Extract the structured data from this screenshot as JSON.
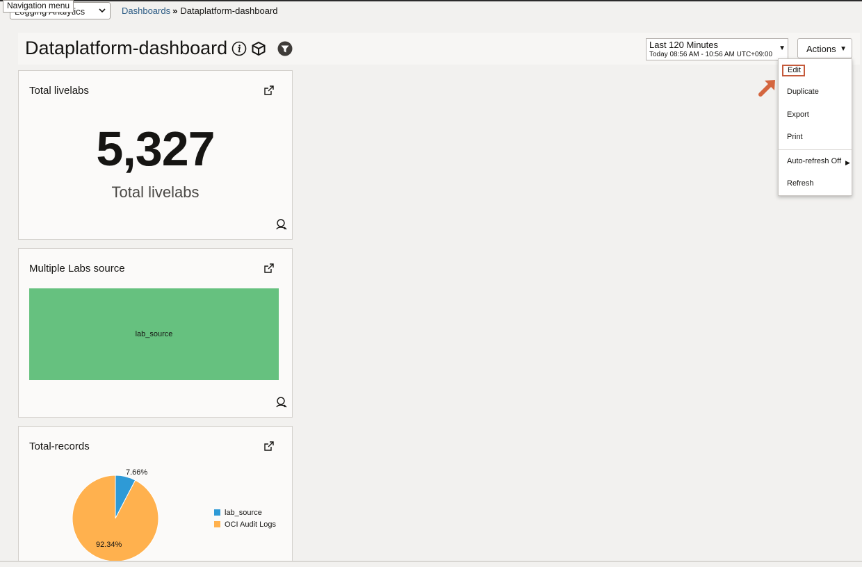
{
  "nav": {
    "tooltip": "Navigation menu",
    "selector_value": "Logging Analytics"
  },
  "breadcrumb": {
    "parent": "Dashboards",
    "separator": "»",
    "current": "Dataplatform-dashboard"
  },
  "header": {
    "title": "Dataplatform-dashboard",
    "icons": [
      "info-icon",
      "cube-icon",
      "filter-icon"
    ],
    "time_range": {
      "label": "Last 120 Minutes",
      "detail": "Today 08:56 AM - 10:56 AM UTC+09:00"
    },
    "actions_label": "Actions"
  },
  "actions_menu": {
    "items": [
      "Edit",
      "Duplicate",
      "Export",
      "Print",
      "Auto-refresh Off",
      "Refresh"
    ],
    "highlighted": "Edit"
  },
  "cards": {
    "total_livelabs": {
      "title": "Total livelabs",
      "value": "5,327",
      "label": "Total livelabs"
    },
    "labs_source": {
      "title": "Multiple Labs source",
      "treemap_label": "lab_source"
    },
    "total_records": {
      "title": "Total-records"
    }
  },
  "colors": {
    "treemap": "#66c17f",
    "lab_source": "#2e9ad6",
    "oci_audit": "#ffb14e",
    "highlight": "#c55a3b",
    "link": "#2b5b84"
  },
  "chart_data": {
    "type": "pie",
    "slices": [
      {
        "name": "lab_source",
        "value": 7.66,
        "label": "7.66%"
      },
      {
        "name": "OCI Audit Logs",
        "value": 92.34,
        "label": "92.34%"
      }
    ],
    "legend": [
      "lab_source",
      "OCI Audit Logs"
    ],
    "legend_position": "right"
  }
}
